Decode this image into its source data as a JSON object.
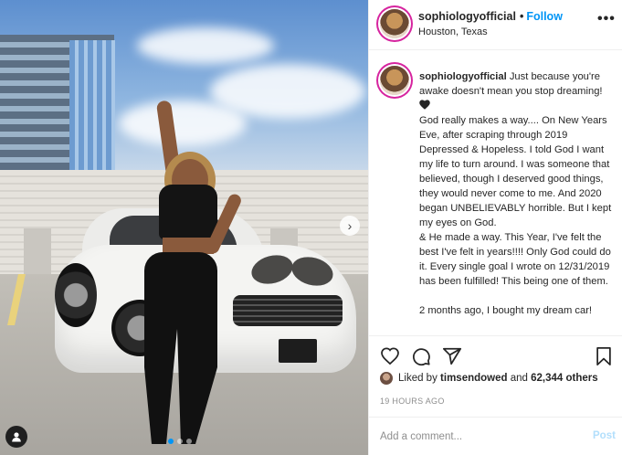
{
  "post": {
    "username": "sophiologyofficial",
    "separator": "•",
    "follow_label": "Follow",
    "location": "Houston, Texas",
    "more_label": "•••",
    "caption_lines": [
      "Just because you're awake doesn't mean you stop dreaming!",
      "God really makes a way.... On New Years Eve, after scraping through 2019 Depressed & Hopeless. I told God I want my life to turn around. I was someone that believed, though I deserved good things, they would never come to me. And 2020 began UNBELIEVABLY horrible. But I kept my eyes on God.",
      "& He made a way. This Year, I've felt the best I've felt in years!!!! Only God could do it. Every single goal I wrote on 12/31/2019 has been fulfilled! This being one of them.",
      "2 months ago, I bought my dream car!"
    ],
    "liked_prefix": "Liked by",
    "liked_user": "timsendowed",
    "liked_joiner": "and",
    "liked_count": "62,344 others",
    "timestamp": "19 HOURS AGO",
    "comment_placeholder": "Add a comment...",
    "post_label": "Post"
  },
  "carousel": {
    "next_label": "›",
    "slide_count": 3,
    "active_slide": 1
  },
  "icons": {
    "heart": "heart-icon",
    "comment": "comment-icon",
    "share": "share-icon",
    "save": "bookmark-icon",
    "tag": "user-tag-icon",
    "black_heart": "black-heart-icon"
  },
  "colors": {
    "accent": "#0095f6",
    "post_disabled": "#b2dffc",
    "muted": "#8e8e8e",
    "text": "#262626"
  }
}
